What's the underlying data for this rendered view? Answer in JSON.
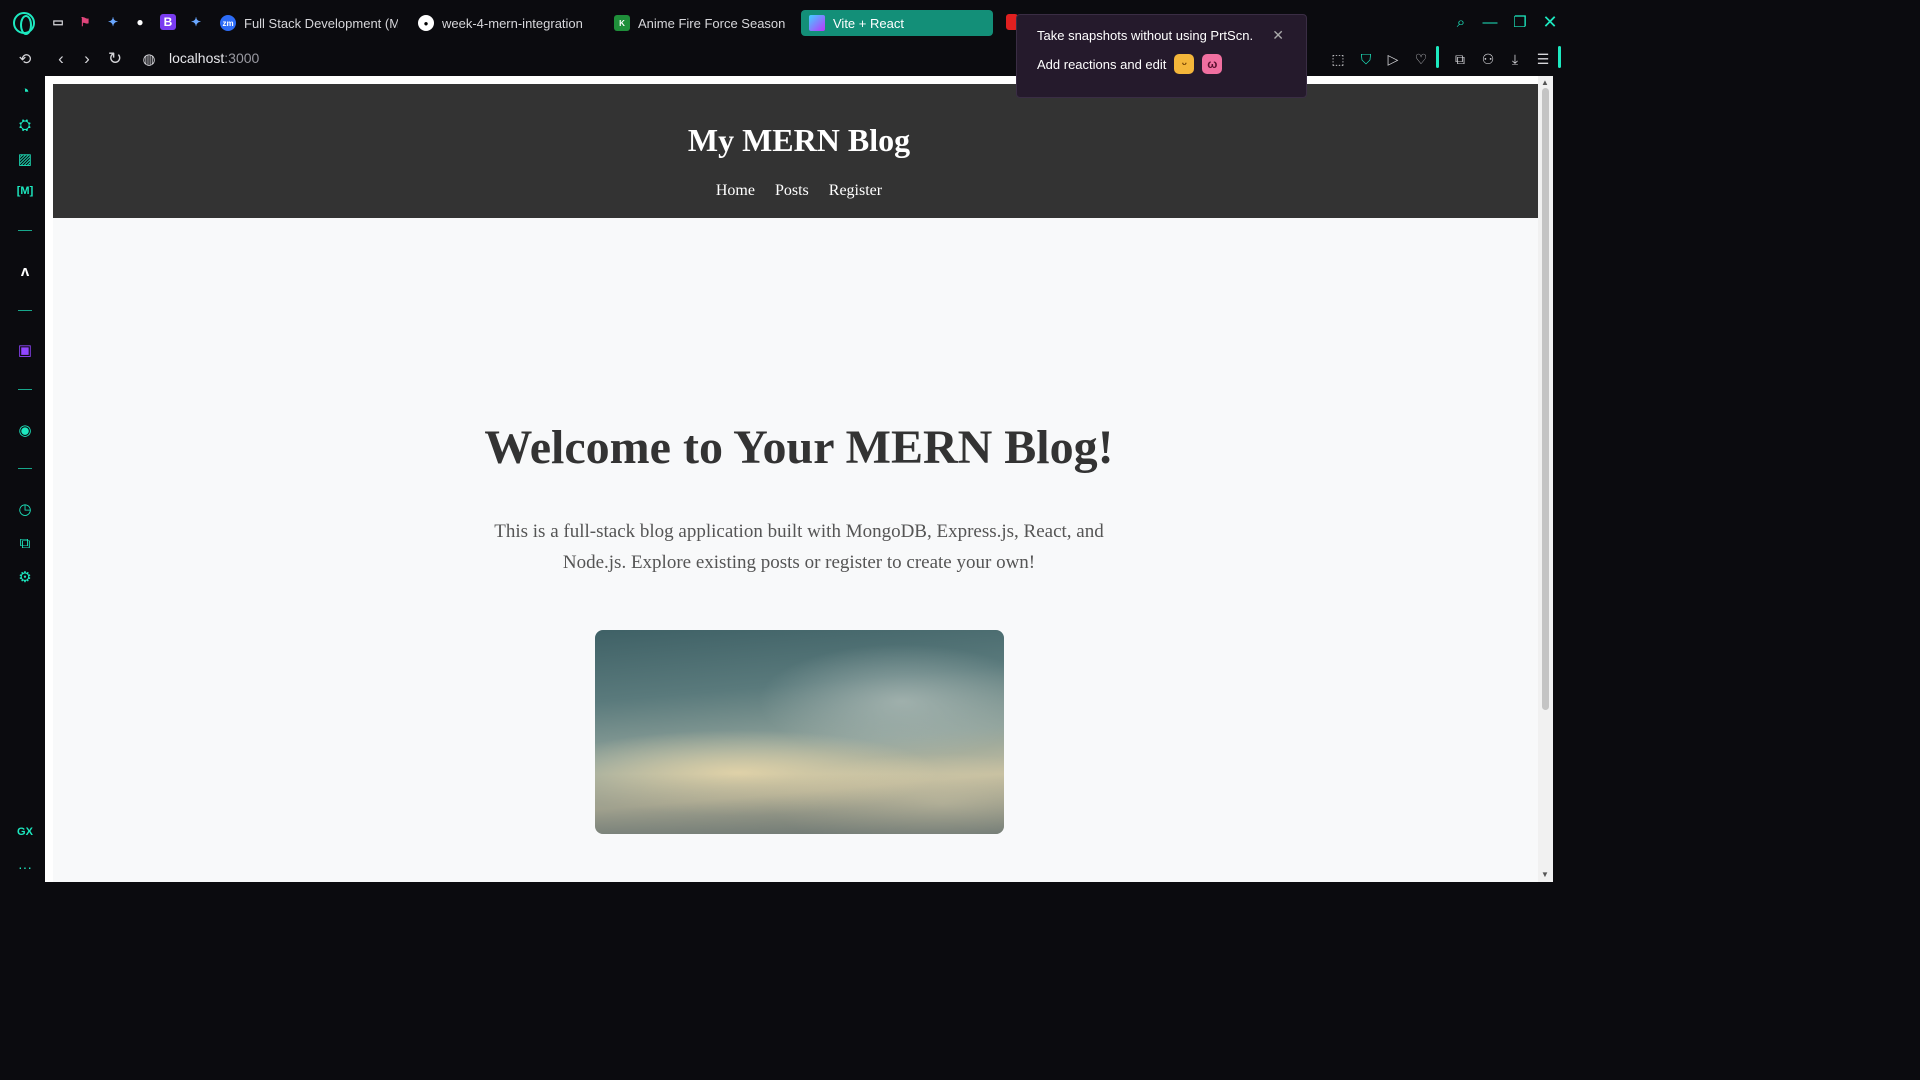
{
  "browser": {
    "accent_color": "#1de9c0",
    "tabs": [
      {
        "label": "Full Stack Development (M",
        "favicon": "zoom-icon",
        "active": false
      },
      {
        "label": "week-4-mern-integration",
        "favicon": "github-icon",
        "active": false
      },
      {
        "label": "Anime Fire Force Season",
        "favicon": "k-icon",
        "active": false
      },
      {
        "label": "Vite + React",
        "favicon": "vite-icon",
        "active": true
      }
    ],
    "pinned_letter": "B",
    "address": {
      "host": "localhost",
      "port": ":3000"
    },
    "sidebar_bottom_label": "GX",
    "sidebar_more": "···"
  },
  "snapshot_tip": {
    "line1": "Take snapshots without using PrtScn.",
    "line2": "Add reactions and edit"
  },
  "site": {
    "title": "My MERN Blog",
    "nav": [
      "Home",
      "Posts",
      "Register"
    ],
    "hero_title": "Welcome to Your MERN Blog!",
    "hero_text": "This is a full-stack blog application built with MongoDB, Express.js, React, and Node.js. Explore existing posts or register to create your own!"
  }
}
